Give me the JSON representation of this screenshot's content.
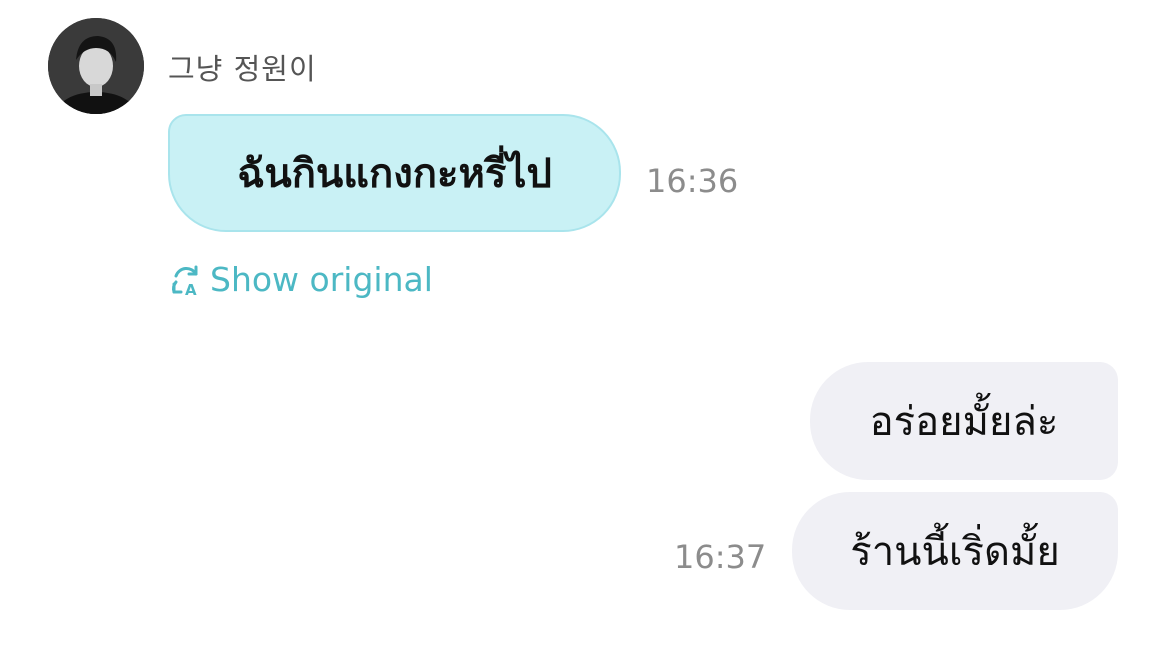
{
  "chat": {
    "sender_name": "그냥 정원이",
    "incoming": {
      "text": "ฉันกินแกงกะหรี่ไป",
      "time": "16:36",
      "show_original_label": "Show original"
    },
    "outgoing": [
      {
        "text": "อร่อยมั้ยล่ะ"
      },
      {
        "text": "ร้านนี้เริ่ดมั้ย",
        "time": "16:37"
      }
    ]
  },
  "colors": {
    "incoming_bubble": "#c9f1f5",
    "outgoing_bubble": "#f0f0f5",
    "accent": "#4cb8c4"
  },
  "icons": {
    "avatar": "avatar",
    "translate": "translate-icon"
  }
}
